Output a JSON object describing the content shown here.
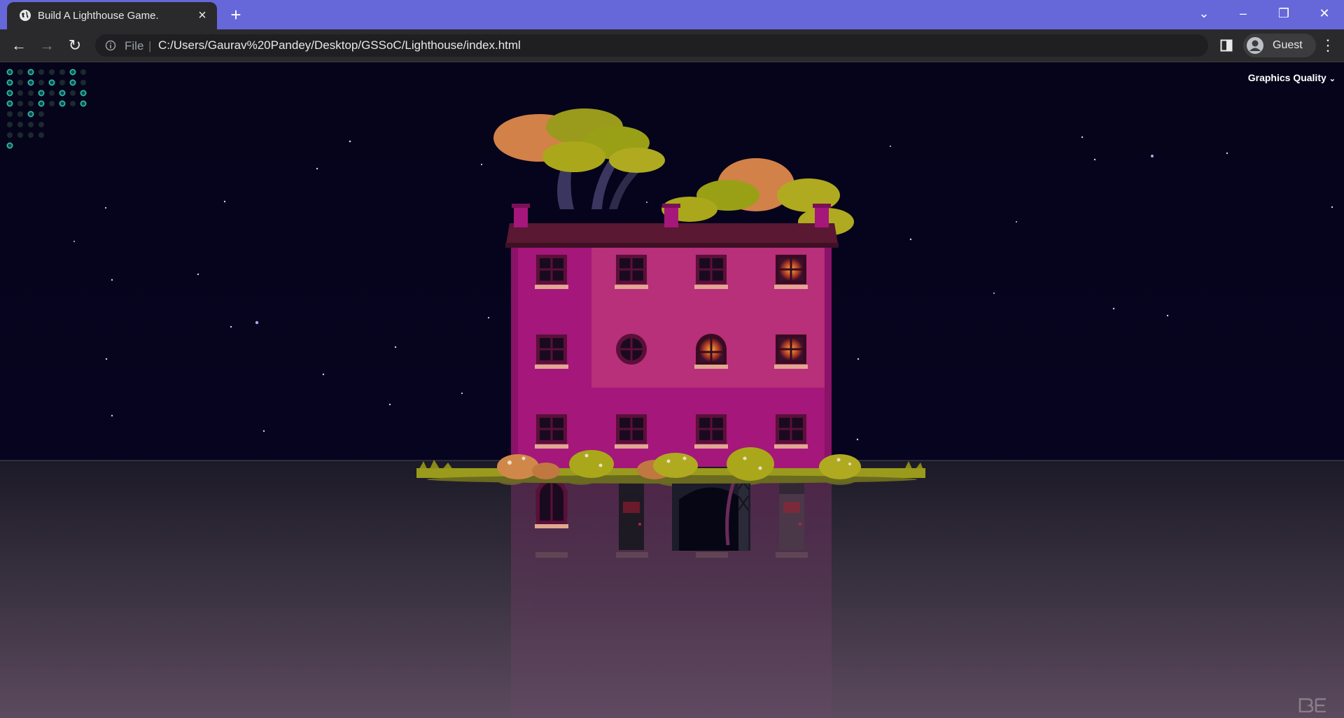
{
  "browser": {
    "tab": {
      "title": "Build A Lighthouse Game.",
      "favicon": "globe-icon",
      "close_icon": "close-icon"
    },
    "new_tab_icon": "plus-icon",
    "window_controls": [
      "chevron-down-icon",
      "minimize-icon",
      "restore-icon",
      "close-icon"
    ],
    "nav": {
      "back_icon": "back-arrow-icon",
      "forward_icon": "forward-arrow-icon",
      "reload_icon": "reload-icon"
    },
    "address_bar": {
      "scheme_label": "File",
      "url": "C:/Users/Gaurav%20Pandey/Desktop/GSSoC/Lighthouse/index.html",
      "info_icon": "info-icon"
    },
    "side_panel_icon": "side-panel-icon",
    "profile": {
      "name": "Guest",
      "icon": "account-circle-icon"
    },
    "menu_icon": "kebab-menu-icon",
    "colors": {
      "frame": "#6667d9",
      "toolbar": "#2a2a2c",
      "omnibox": "#1f1f21"
    }
  },
  "page": {
    "graphics_quality": {
      "label": "Graphics Quality",
      "icon": "chevron-down-icon"
    },
    "watermark": {
      "icon": "be-logo-icon"
    },
    "scene": {
      "description_icon": "townhouse-island-illustration",
      "colors": {
        "sky": "#06041a",
        "wall": "#a5177a",
        "roof": "#5a1833",
        "foliage": "#9aa016",
        "tree_orange": "#d7844a",
        "water": "#2f2838",
        "window_glow": "#ff9c2a"
      }
    }
  }
}
